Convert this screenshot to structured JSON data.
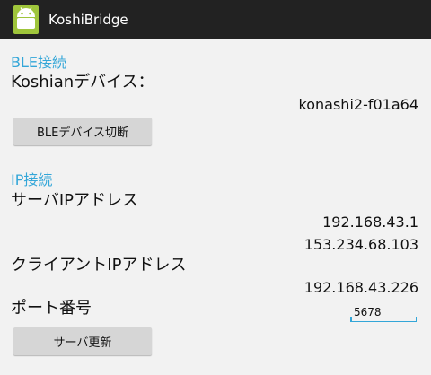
{
  "app": {
    "title": "KoshiBridge",
    "icon": "android-robot-icon",
    "accent_color": "#33a6d8"
  },
  "ble": {
    "section_title": "BLE接続",
    "device_label": "Koshianデバイス：",
    "device_name": "konashi2-f01a64",
    "disconnect_button": "BLEデバイス切断"
  },
  "ip": {
    "section_title": "IP接続",
    "server_label": "サーバIPアドレス",
    "server_addresses": [
      "192.168.43.1",
      "153.234.68.103"
    ],
    "client_label": "クライアントIPアドレス",
    "client_address": "192.168.43.226",
    "port_label": "ポート番号",
    "port_value": "5678",
    "update_button": "サーバ更新"
  }
}
